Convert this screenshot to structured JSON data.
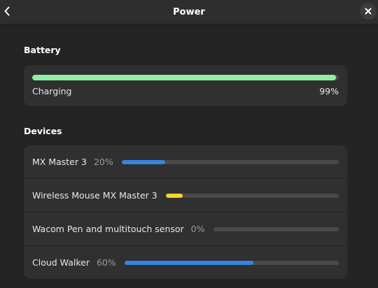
{
  "header": {
    "title": "Power",
    "back_icon": "chevron-left-icon",
    "close_icon": "close-icon"
  },
  "battery": {
    "heading": "Battery",
    "status": "Charging",
    "percent_text": "99%",
    "level": 0.99,
    "color": "#8ff0a4"
  },
  "devices": {
    "heading": "Devices",
    "items": [
      {
        "name": "MX Master 3",
        "percent_text": "20%",
        "level": 0.2,
        "color": "#3584e4"
      },
      {
        "name": "Wireless Mouse MX Master 3",
        "percent_text": "",
        "level": 0.1,
        "color": "#f6d32d"
      },
      {
        "name": "Wacom Pen and multitouch sensor",
        "percent_text": "0%",
        "level": 0.0,
        "color": "#3584e4"
      },
      {
        "name": "Cloud Walker",
        "percent_text": "60%",
        "level": 0.6,
        "color": "#3584e4"
      }
    ]
  }
}
